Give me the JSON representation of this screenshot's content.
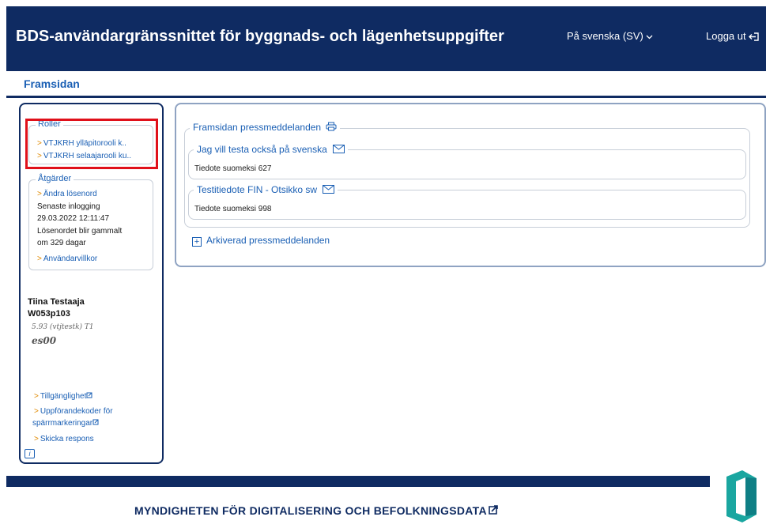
{
  "header": {
    "title": "BDS-användargränssnittet för byggnads- och lägenhetsuppgifter",
    "language_label": "På svenska  (SV)",
    "logout_label": "Logga ut"
  },
  "breadcrumb": {
    "page_title": "Framsidan"
  },
  "sidebar": {
    "roles": {
      "legend": "Roller",
      "items": [
        {
          "label": "VTJKRH ylläpitorooli k.."
        },
        {
          "label": "VTJKRH selaajarooli ku.."
        }
      ]
    },
    "actions": {
      "legend": "Åtgärder",
      "change_password": "Ändra lösenord",
      "last_login_label": "Senaste inlogging",
      "last_login_value": "29.03.2022 12:11:47",
      "password_expiry_1": "Lösenordet blir gammalt",
      "password_expiry_2": "om 329 dagar",
      "terms": "Användarvillkor"
    },
    "user": {
      "name": "Tiina Testaaja",
      "id": "W053p103",
      "version": "5.93 (vtjtestk) T1",
      "environment": "es00"
    },
    "links": {
      "accessibility": "Tillgänglighet",
      "codes_line1": "Uppförandekoder för",
      "codes_line2": "spärrmarkeringar",
      "feedback": "Skicka respons"
    },
    "info_icon_text": "i"
  },
  "main": {
    "press_legend": "Framsidan pressmeddelanden",
    "items": [
      {
        "title": "Jag vill testa också på svenska",
        "body": "Tiedote suomeksi 627"
      },
      {
        "title": "Testitiedote FIN - Otsikko sw",
        "body": "Tiedote suomeksi 998"
      }
    ],
    "archive_label": "Arkiverad pressmeddelanden"
  },
  "footer": {
    "agency": "MYNDIGHETEN FÖR DIGITALISERING OCH BEFOLKNINGSDATA"
  },
  "colors": {
    "brand_navy": "#0f2b62",
    "link_blue": "#1a5fb4",
    "chevron_orange": "#e08a00",
    "highlight_red": "#e0101a",
    "logo_teal": "#1aa6a0"
  },
  "icons": [
    "chevron-down-icon",
    "logout-icon",
    "print-icon",
    "mail-icon",
    "external-link-icon",
    "plus-icon",
    "info-icon",
    "dvv-logo"
  ]
}
